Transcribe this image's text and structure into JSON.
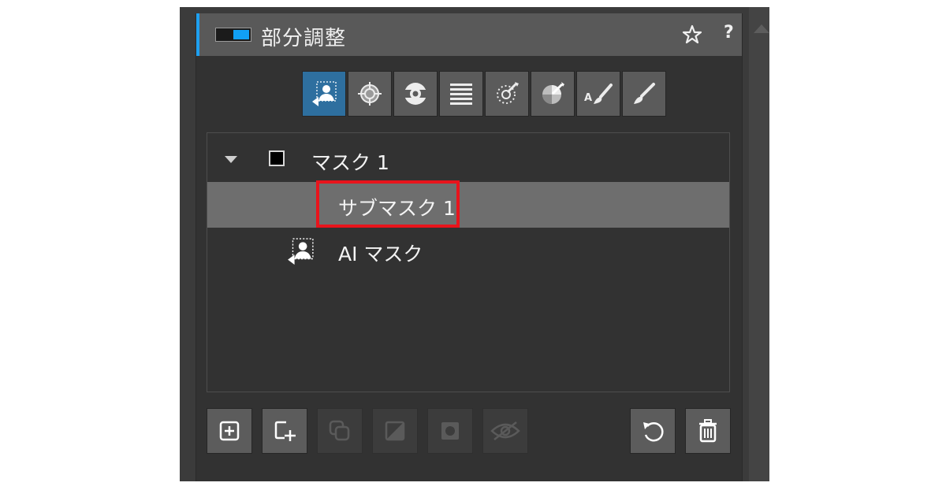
{
  "panel": {
    "title": "部分調整",
    "help_label": "?",
    "enabled": true,
    "accent_color": "#1ea0f0"
  },
  "tools": [
    {
      "name": "ai-mask-tool",
      "icon": "person-silhouette-icon",
      "active": true
    },
    {
      "name": "radial-tool",
      "icon": "crosshair-target-icon",
      "active": false
    },
    {
      "name": "concentric-tool",
      "icon": "concentric-circles-icon",
      "active": false
    },
    {
      "name": "linear-gradient-tool",
      "icon": "horizontal-lines-icon",
      "active": false
    },
    {
      "name": "color-picker-tool",
      "icon": "dotted-circle-picker-icon",
      "active": false
    },
    {
      "name": "luminance-tool",
      "icon": "sphere-picker-icon",
      "active": false
    },
    {
      "name": "auto-brush-tool",
      "icon": "auto-brush-icon",
      "active": false
    },
    {
      "name": "brush-tool",
      "icon": "brush-icon",
      "active": false
    }
  ],
  "mask_list": {
    "items": [
      {
        "label": "マスク 1",
        "level": 0,
        "expanded": true,
        "selected": false
      },
      {
        "label": "サブマスク 1",
        "level": 1,
        "selected": true,
        "highlighted": true
      },
      {
        "label": "AI マスク",
        "level": 1,
        "selected": false,
        "icon": "person-silhouette-icon"
      }
    ]
  },
  "bottom_buttons": [
    {
      "name": "add-mask",
      "icon": "plus-square-icon",
      "enabled": true
    },
    {
      "name": "add-submask",
      "icon": "plus-corner-square-icon",
      "enabled": true
    },
    {
      "name": "duplicate",
      "icon": "duplicate-icon",
      "enabled": false
    },
    {
      "name": "invert",
      "icon": "invert-icon",
      "enabled": false
    },
    {
      "name": "mask-overlay",
      "icon": "circle-in-square-icon",
      "enabled": false
    },
    {
      "name": "hide-mask",
      "icon": "eye-slash-icon",
      "enabled": false
    },
    {
      "name": "reset",
      "icon": "undo-icon",
      "enabled": true
    },
    {
      "name": "delete",
      "icon": "trash-icon",
      "enabled": true
    }
  ],
  "colors": {
    "selected_row": "#6e6e6e",
    "highlight_border": "#e8141c",
    "active_tool": "#2e6f9f"
  }
}
